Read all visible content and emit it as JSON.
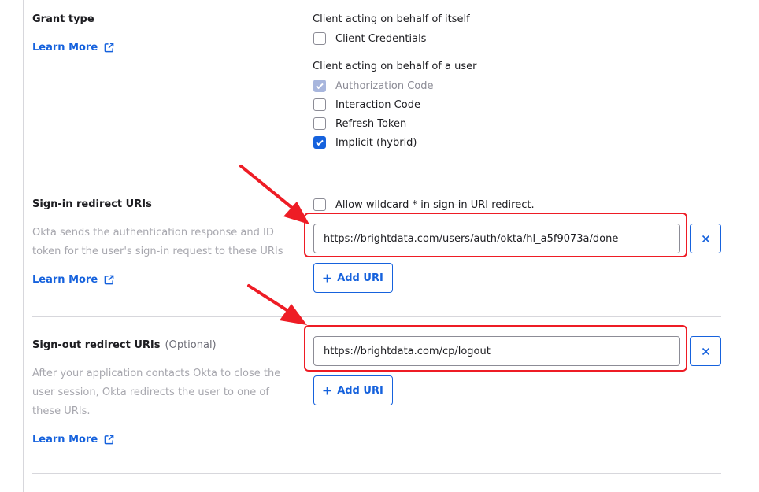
{
  "grant_type": {
    "title": "Grant type",
    "learn_more": "Learn More",
    "group_itself": "Client acting on behalf of itself",
    "client_credentials": "Client Credentials",
    "group_user": "Client acting on behalf of a user",
    "authorization_code": "Authorization Code",
    "interaction_code": "Interaction Code",
    "refresh_token": "Refresh Token",
    "implicit_hybrid": "Implicit (hybrid)"
  },
  "sign_in": {
    "title": "Sign-in redirect URIs",
    "description": "Okta sends the authentication response and ID token for the user's sign-in request to these URIs",
    "learn_more": "Learn More",
    "wildcard_label": "Allow wildcard * in sign-in URI redirect.",
    "uri_value": "https://brightdata.com/users/auth/okta/hl_a5f9073a/done",
    "add_uri": "Add URI"
  },
  "sign_out": {
    "title": "Sign-out redirect URIs",
    "optional": "(Optional)",
    "description": "After your application contacts Okta to close the user session, Okta redirects the user to one of these URIs.",
    "learn_more": "Learn More",
    "uri_value": "https://brightdata.com/cp/logout",
    "add_uri": "Add URI"
  },
  "colors": {
    "accent": "#1662dd",
    "annotation": "#ee1c25"
  },
  "icons": {
    "external_link": "external-link-icon",
    "checkmark": "checkmark-icon",
    "close": "close-icon",
    "plus": "plus-icon"
  }
}
